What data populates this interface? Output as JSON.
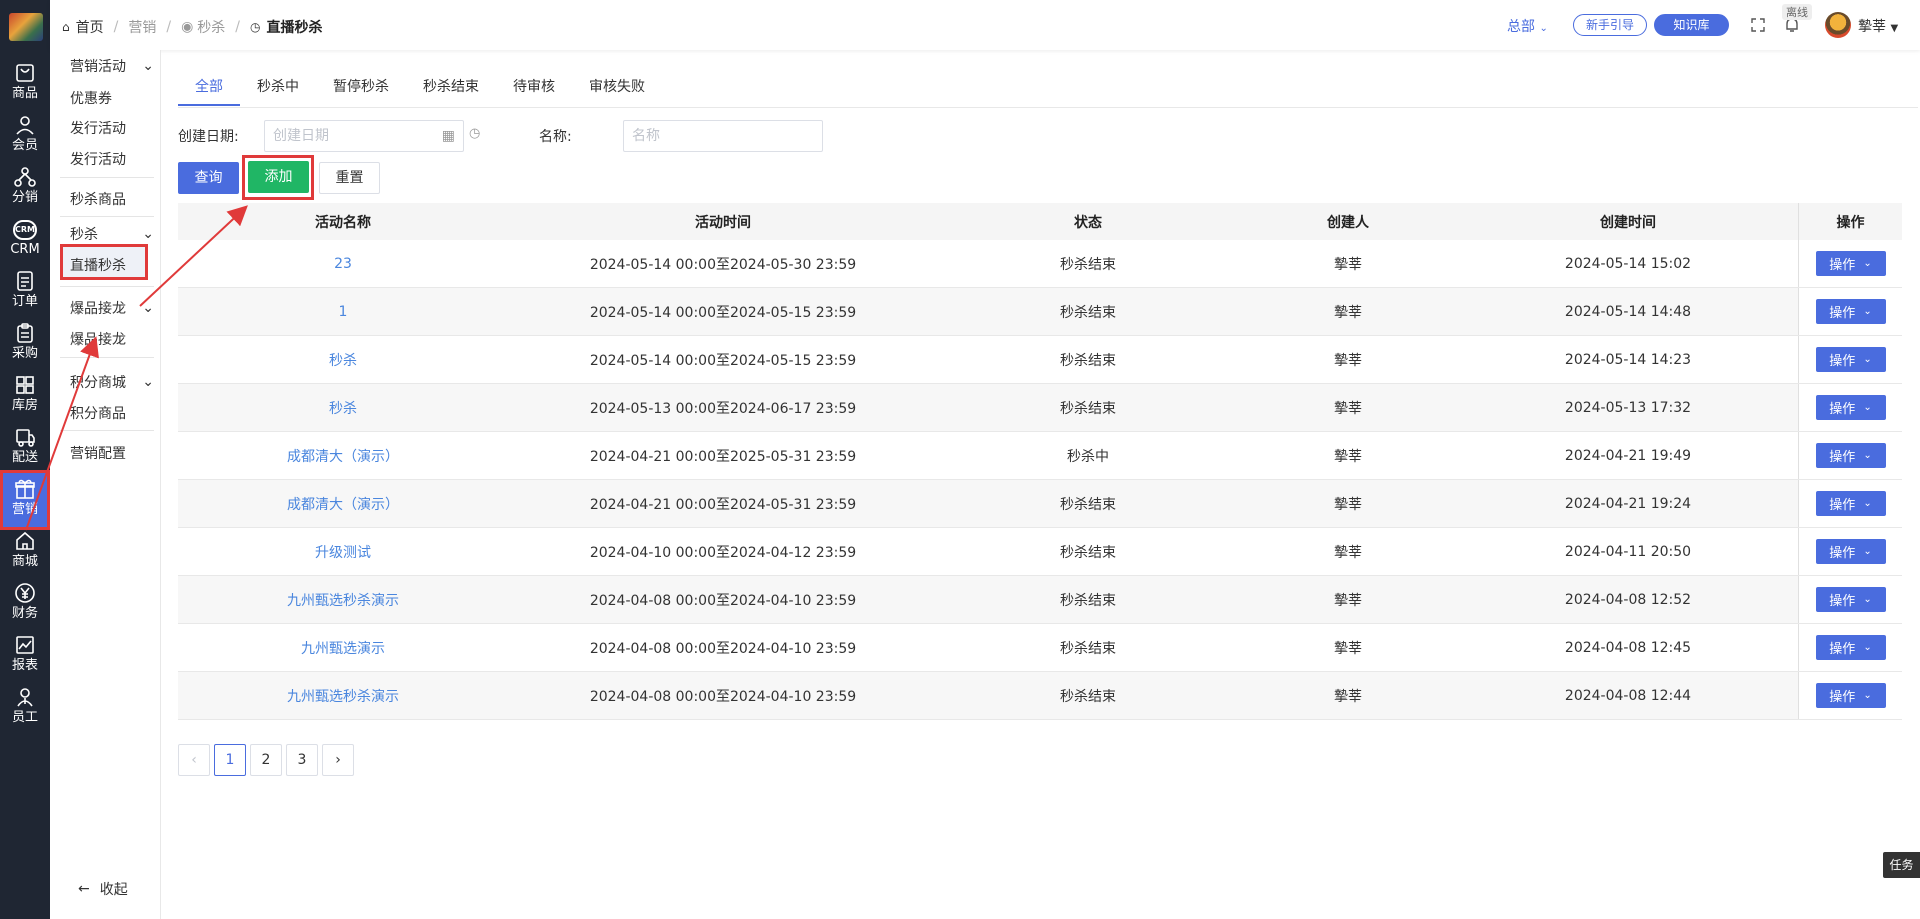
{
  "rail": {
    "items": [
      {
        "label": "商品",
        "icon": "bag-icon"
      },
      {
        "label": "会员",
        "icon": "user-icon"
      },
      {
        "label": "分销",
        "icon": "network-icon"
      },
      {
        "label": "CRM",
        "icon": "crm-icon"
      },
      {
        "label": "订单",
        "icon": "order-icon"
      },
      {
        "label": "采购",
        "icon": "clipboard-icon"
      },
      {
        "label": "库房",
        "icon": "warehouse-icon"
      },
      {
        "label": "配送",
        "icon": "delivery-icon"
      },
      {
        "label": "营销",
        "icon": "gift-icon"
      },
      {
        "label": "商城",
        "icon": "home-icon"
      },
      {
        "label": "财务",
        "icon": "yen-icon"
      },
      {
        "label": "报表",
        "icon": "chart-icon"
      },
      {
        "label": "员工",
        "icon": "staff-icon"
      }
    ],
    "crm_badge": "CRM"
  },
  "submenu": {
    "g1": "营销活动",
    "coupon": "优惠券",
    "issue1": "发行活动",
    "issue2": "发行活动",
    "flash_goods": "秒杀商品",
    "g2": "秒杀",
    "live_flash": "直播秒杀",
    "g3": "爆品接龙",
    "hot_relay": "爆品接龙",
    "g4": "积分商城",
    "points_goods": "积分商品",
    "config": "营销配置",
    "collapse": "收起"
  },
  "topbar": {
    "home": "首页",
    "crumb1": "营销",
    "crumb2": "秒杀",
    "crumb3": "直播秒杀",
    "hq": "总部",
    "guide": "新手引导",
    "kb": "知识库",
    "offline": "离线",
    "user": "摯莘"
  },
  "tabs": [
    "全部",
    "秒杀中",
    "暂停秒杀",
    "秒杀结束",
    "待审核",
    "审核失败"
  ],
  "filters": {
    "date_label": "创建日期:",
    "date_placeholder": "创建日期",
    "name_label": "名称:",
    "name_placeholder": "名称"
  },
  "buttons": {
    "query": "查询",
    "add": "添加",
    "reset": "重置"
  },
  "table": {
    "headers": [
      "活动名称",
      "活动时间",
      "状态",
      "创建人",
      "创建时间",
      "操作"
    ],
    "op_label": "操作",
    "rows": [
      {
        "name": "23",
        "time": "2024-05-14 00:00至2024-05-30 23:59",
        "status": "秒杀结束",
        "creator": "摯莘",
        "created": "2024-05-14 15:02"
      },
      {
        "name": "1",
        "time": "2024-05-14 00:00至2024-05-15 23:59",
        "status": "秒杀结束",
        "creator": "摯莘",
        "created": "2024-05-14 14:48"
      },
      {
        "name": "秒杀",
        "time": "2024-05-14 00:00至2024-05-15 23:59",
        "status": "秒杀结束",
        "creator": "摯莘",
        "created": "2024-05-14 14:23"
      },
      {
        "name": "秒杀",
        "time": "2024-05-13 00:00至2024-06-17 23:59",
        "status": "秒杀结束",
        "creator": "摯莘",
        "created": "2024-05-13 17:32"
      },
      {
        "name": "成都清大（演示）",
        "time": "2024-04-21 00:00至2025-05-31 23:59",
        "status": "秒杀中",
        "creator": "摯莘",
        "created": "2024-04-21 19:49"
      },
      {
        "name": "成都清大（演示）",
        "time": "2024-04-21 00:00至2024-05-31 23:59",
        "status": "秒杀结束",
        "creator": "摯莘",
        "created": "2024-04-21 19:24"
      },
      {
        "name": "升级测试",
        "time": "2024-04-10 00:00至2024-04-12 23:59",
        "status": "秒杀结束",
        "creator": "摯莘",
        "created": "2024-04-11 20:50"
      },
      {
        "name": "九州甄选秒杀演示",
        "time": "2024-04-08 00:00至2024-04-10 23:59",
        "status": "秒杀结束",
        "creator": "摯莘",
        "created": "2024-04-08 12:52"
      },
      {
        "name": "九州甄选演示",
        "time": "2024-04-08 00:00至2024-04-10 23:59",
        "status": "秒杀结束",
        "creator": "摯莘",
        "created": "2024-04-08 12:45"
      },
      {
        "name": "九州甄选秒杀演示",
        "time": "2024-04-08 00:00至2024-04-10 23:59",
        "status": "秒杀结束",
        "creator": "摯莘",
        "created": "2024-04-08 12:44"
      }
    ]
  },
  "pager": {
    "prev": "‹",
    "pages": [
      "1",
      "2",
      "3"
    ],
    "next": "›",
    "current": 1
  },
  "task": "任务",
  "colors": {
    "primary": "#4a6cde",
    "green": "#20b665",
    "highlight": "#e03a3a",
    "rail": "#1f2633"
  }
}
